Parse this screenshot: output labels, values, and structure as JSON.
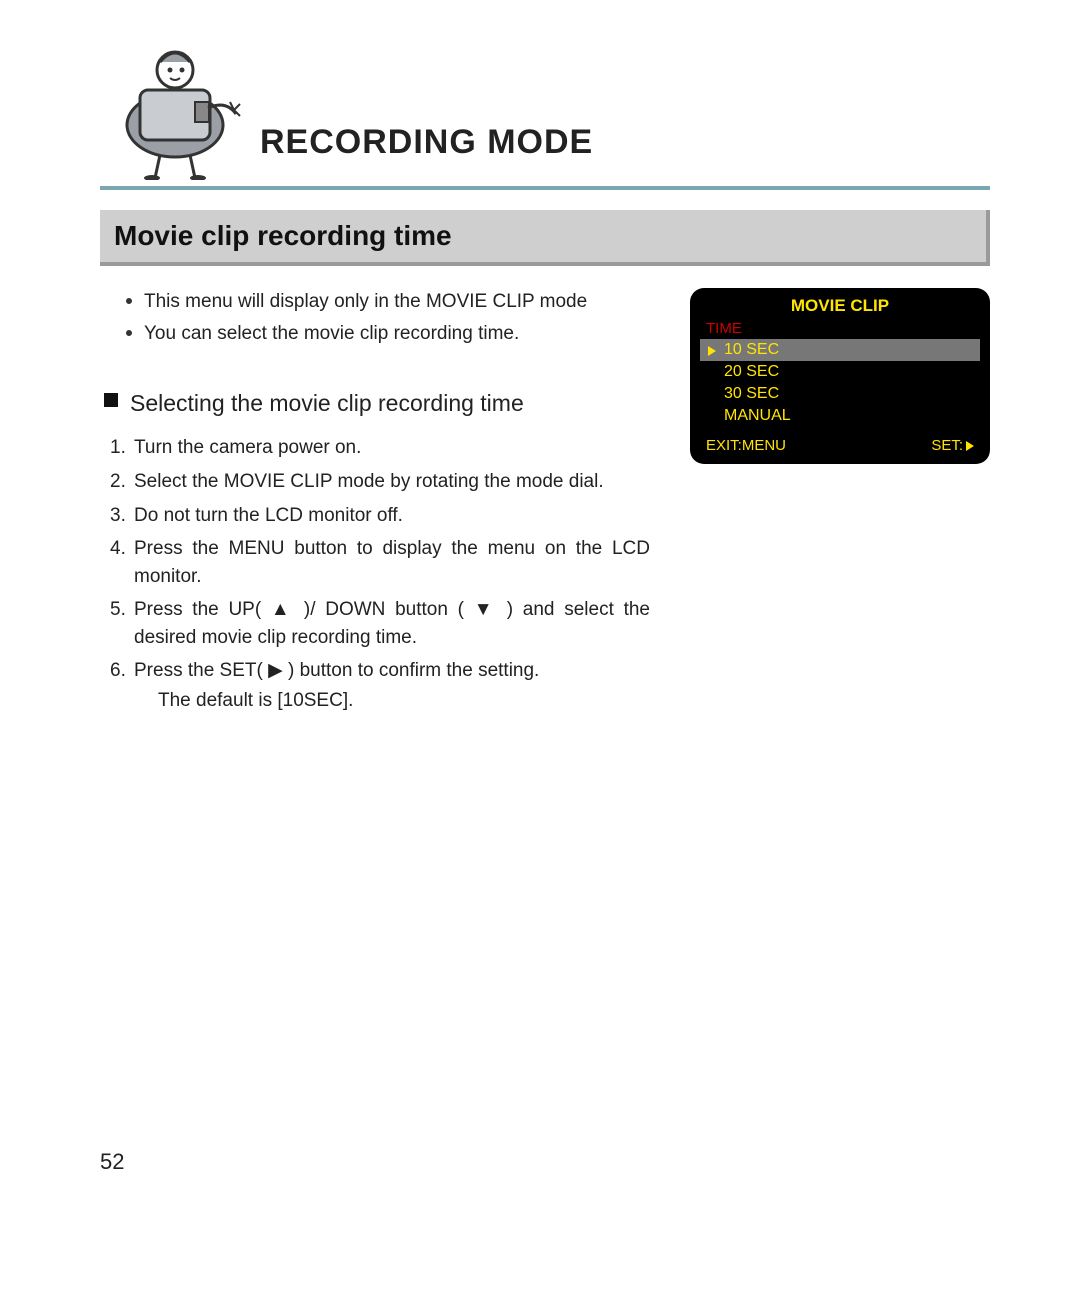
{
  "chapter_title": "RECORDING MODE",
  "section_title": "Movie clip recording time",
  "bullets": [
    "This menu will display only in the MOVIE CLIP mode",
    "You can select the movie clip recording time."
  ],
  "subhead": "Selecting the movie clip recording time",
  "steps": [
    "Turn the camera power on.",
    "Select the MOVIE CLIP mode by rotating the mode dial.",
    "Do not turn the LCD monitor off.",
    "Press the MENU button to display the menu on the LCD monitor.",
    "Press the UP( ▲ )/ DOWN button ( ▼ ) and select the desired movie clip recording time.",
    "Press the SET( ▶ ) button to confirm the setting."
  ],
  "step6_extra": "The default is [10SEC].",
  "lcd": {
    "title": "MOVIE CLIP",
    "label": "TIME",
    "options": [
      "10  SEC",
      "20  SEC",
      "30  SEC",
      "MANUAL"
    ],
    "selected_index": 0,
    "footer_left": "EXIT:MENU",
    "footer_right": "SET:"
  },
  "page_number": "52"
}
